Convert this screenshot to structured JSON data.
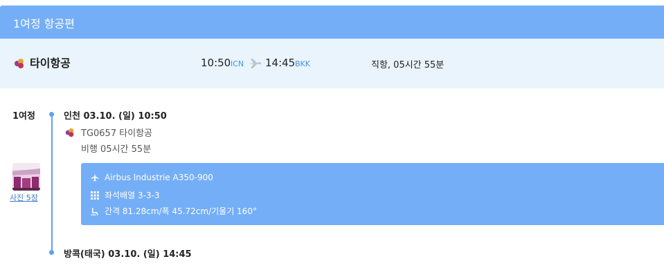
{
  "header": {
    "title": "1여정 항공편"
  },
  "summary": {
    "airline": "타이항공",
    "departure_time": "10:50",
    "departure_code": "ICN",
    "arrival_time": "14:45",
    "arrival_code": "BKK",
    "duration": "직항, 05시간 55분"
  },
  "itinerary": {
    "leg_label": "1여정",
    "departure": "인천 03.10. (일) 10:50",
    "flight": "TG0657 타이항공",
    "flight_time": "비행 05시간 55분",
    "photo_link": "사진 5장",
    "aircraft": {
      "model": "Airbus Industrie A350-900",
      "seat_layout": "좌석배열 3-3-3",
      "seat_spec": "간격 81.28cm/폭 45.72cm/기울기 160°"
    },
    "arrival": "방콕(태국) 03.10. (일) 14:45"
  },
  "colors": {
    "accent": "#74aef7",
    "summary_bg": "#e9f4fd",
    "timeline": "#5fa0ef",
    "code": "#4a90d9"
  },
  "icons": [
    "thai-airways-logo-icon",
    "plane-icon",
    "airplane-icon",
    "seat-grid-icon",
    "seat-recline-icon"
  ]
}
